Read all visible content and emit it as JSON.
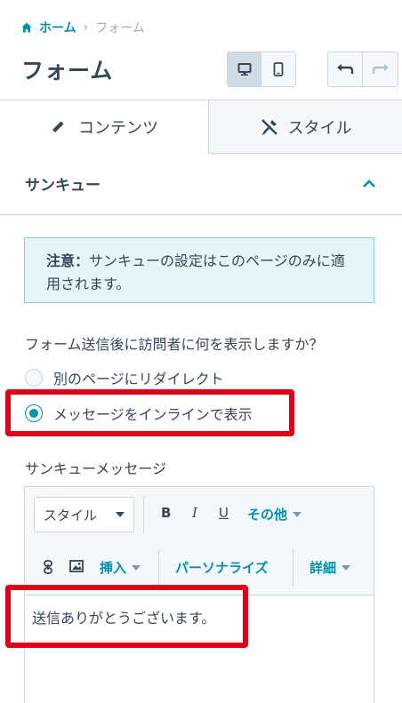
{
  "breadcrumb": {
    "home": "ホーム",
    "separator": "›",
    "current": "フォーム"
  },
  "page_title": "フォーム",
  "view_toggle": {
    "desktop_icon": "desktop-icon",
    "mobile_icon": "mobile-icon",
    "active": "desktop"
  },
  "history": {
    "undo_icon": "undo-icon",
    "redo_icon": "redo-icon"
  },
  "tabs": [
    {
      "label": "コンテンツ",
      "icon": "pencil-icon",
      "active": true
    },
    {
      "label": "スタイル",
      "icon": "brush-icon",
      "active": false
    }
  ],
  "section": {
    "title": "サンキュー",
    "icon": "chevron-up-icon"
  },
  "notice": {
    "strong": "注意：",
    "text": "サンキューの設定はこのページのみに適用されます。"
  },
  "question": "フォーム送信後に訪問者に何を表示しますか？",
  "options": [
    {
      "label": "別のページにリダイレクト",
      "checked": false
    },
    {
      "label": "メッセージをインラインで表示",
      "checked": true
    }
  ],
  "message_label": "サンキューメッセージ",
  "toolbar": {
    "style_select": "スタイル",
    "bold": "B",
    "italic": "I",
    "underline": "U",
    "more": "その他",
    "insert": "挿入",
    "personalize": "パーソナライズ",
    "advanced": "詳細"
  },
  "editor_text": "送信ありがとうございます。",
  "colors": {
    "accent": "#0091ae",
    "highlight": "#e0001a",
    "text": "#33475b"
  }
}
